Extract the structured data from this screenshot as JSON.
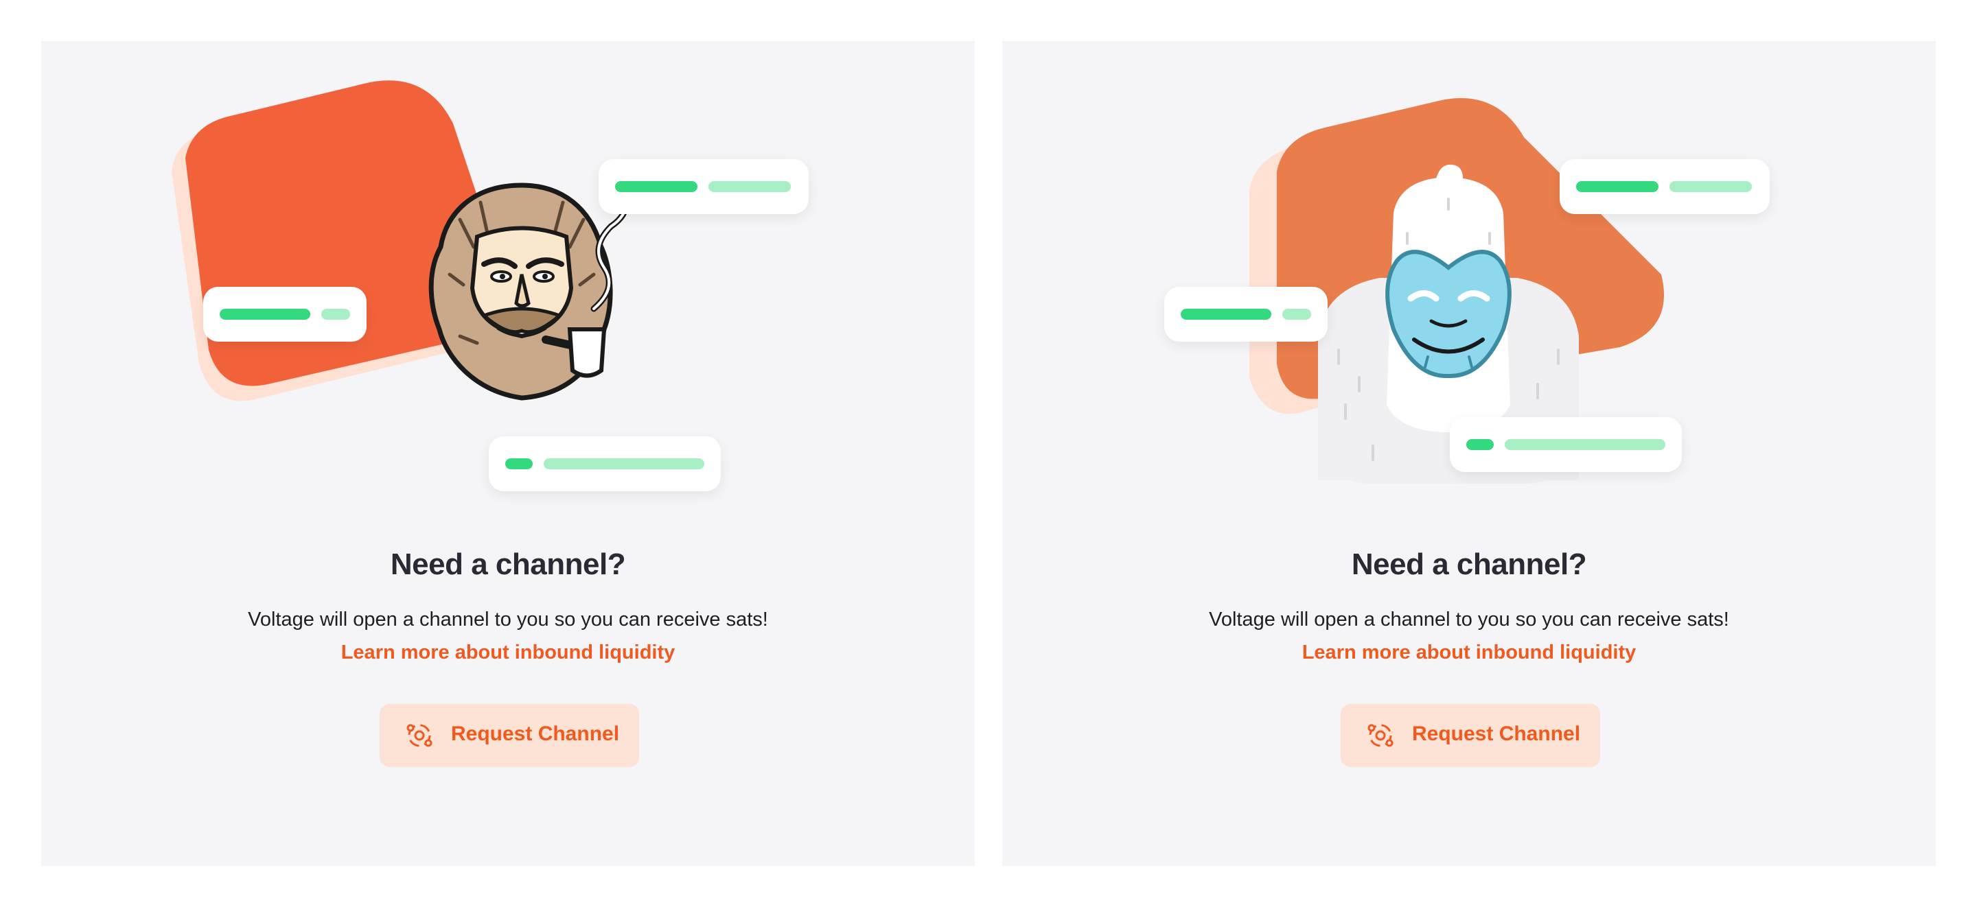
{
  "panels": [
    {
      "variant": "bearded-mascot",
      "title": "Need a channel?",
      "description": "Voltage will open a channel to you so you can receive sats!",
      "link_label": "Learn more about inbound liquidity",
      "button_label": "Request Channel",
      "button_icon": "channel-request-icon"
    },
    {
      "variant": "yeti-mascot",
      "title": "Need a channel?",
      "description": "Voltage will open a channel to you so you can receive sats!",
      "link_label": "Learn more about inbound liquidity",
      "button_label": "Request Channel",
      "button_icon": "channel-request-icon"
    }
  ],
  "colors": {
    "panel_background": "#f5f5f7",
    "brand_orange": "#f05a1e",
    "button_background": "#fde3d5",
    "blob_orange_left": "#f2623a",
    "blob_orange_right": "#e97d4c",
    "pill_green": "#34d97f",
    "pill_green_light": "#a8efc6",
    "title_text": "#2a2a35"
  }
}
